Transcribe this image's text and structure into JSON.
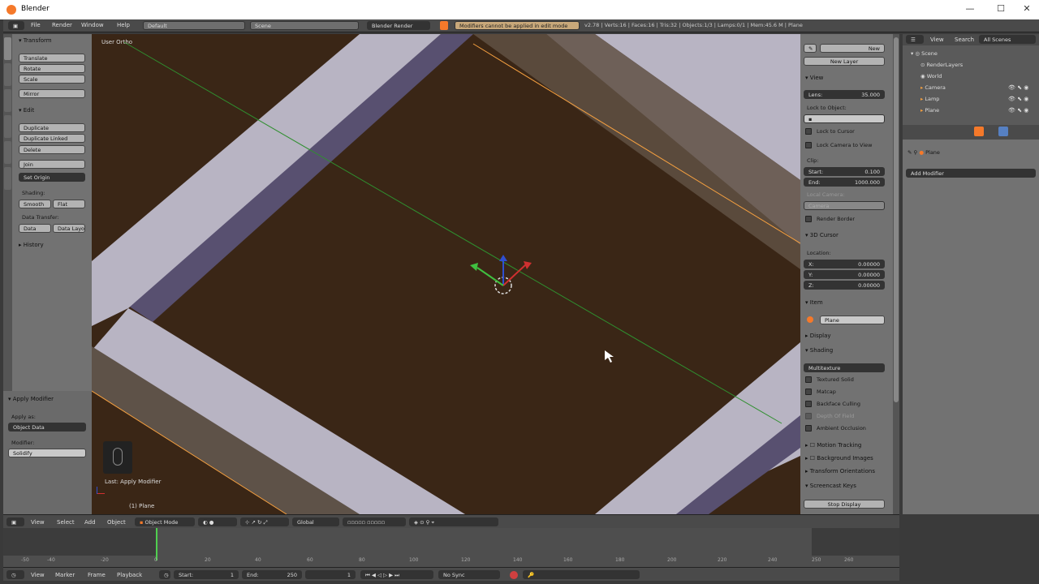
{
  "window": {
    "title": "Blender",
    "min": "—",
    "max": "☐",
    "close": "✕"
  },
  "topbar": {
    "menus": [
      "File",
      "Render",
      "Window",
      "Help"
    ],
    "layout": "Default",
    "scene": "Scene",
    "engine": "Blender Render",
    "warning": "Modifiers cannot be applied in edit mode",
    "stats": "v2.78 | Verts:16 | Faces:16 | Tris:32 | Objects:1/3 | Lamps:0/1 | Mem:45.6 M | Plane"
  },
  "toolshelf": {
    "tabs": [
      "Tools",
      "Create",
      "Relations",
      "Animation",
      "Physics",
      "Grease Pencil"
    ],
    "transform_header": "Transform",
    "transform": [
      "Translate",
      "Rotate",
      "Scale",
      "Mirror"
    ],
    "edit_header": "Edit",
    "edit": [
      "Duplicate",
      "Duplicate Linked",
      "Delete",
      "Join"
    ],
    "set_origin": "Set Origin",
    "shading_label": "Shading:",
    "smooth": "Smooth",
    "flat": "Flat",
    "data_transfer_label": "Data Transfer:",
    "data": "Data",
    "data_layout": "Data Layo",
    "history": "History"
  },
  "operator": {
    "header": "Apply Modifier",
    "apply_as_label": "Apply as:",
    "apply_as": "Object Data",
    "modifier_label": "Modifier:",
    "modifier": "Solidify"
  },
  "viewport": {
    "view_label": "User Ortho",
    "last_op": "Last: Apply Modifier",
    "object_label": "(1) Plane"
  },
  "npanel": {
    "new": "New",
    "new_layer": "New Layer",
    "view_header": "View",
    "lens_label": "Lens:",
    "lens": "35.000",
    "lock_label": "Lock to Object:",
    "lock_cursor": "Lock to Cursor",
    "lock_camera": "Lock Camera to View",
    "clip_label": "Clip:",
    "start_label": "Start:",
    "start": "0.100",
    "end_label": "End:",
    "end": "1000.000",
    "local_camera": "Local Camera:",
    "camera": "Camera",
    "render_border": "Render Border",
    "cursor_header": "3D Cursor",
    "location_label": "Location:",
    "x_label": "X:",
    "x": "0.00000",
    "y_label": "Y:",
    "y": "0.00000",
    "z_label": "Z:",
    "z": "0.00000",
    "item_header": "Item",
    "item": "Plane",
    "display": "Display",
    "shading_header": "Shading",
    "matcap_mode": "Multitexture",
    "textured_solid": "Textured Solid",
    "matcap": "Matcap",
    "backface": "Backface Culling",
    "dof": "Depth Of Field",
    "ao": "Ambient Occlusion",
    "motion": "Motion Tracking",
    "bg": "Background Images",
    "transform_orient": "Transform Orientations",
    "screencast": "Screencast Keys",
    "stop_display": "Stop Display"
  },
  "outliner": {
    "view": "View",
    "search": "Search",
    "all_scenes": "All Scenes",
    "scene": "Scene",
    "render_layers": "RenderLayers",
    "world": "World",
    "camera": "Camera",
    "lamp": "Lamp",
    "plane": "Plane"
  },
  "properties": {
    "object": "Plane",
    "add_modifier": "Add Modifier"
  },
  "header3d": {
    "menus": [
      "View",
      "Select",
      "Add",
      "Object"
    ],
    "mode": "Object Mode",
    "orientation": "Global"
  },
  "timeline": {
    "ticks": [
      "-50",
      "-40",
      "-20",
      "0",
      "20",
      "40",
      "60",
      "80",
      "100",
      "120",
      "140",
      "160",
      "180",
      "200",
      "220",
      "240",
      "250",
      "260"
    ],
    "menus": [
      "View",
      "Marker",
      "Frame",
      "Playback"
    ],
    "start_label": "Start:",
    "start": "1",
    "end_label": "End:",
    "end": "250",
    "current": "1",
    "sync": "No Sync"
  },
  "colors": {
    "viewport_bg": "#3a2616",
    "mesh_light": "#b8b4c3",
    "mesh_shadow": "#585070",
    "accent": "#f5792a"
  }
}
